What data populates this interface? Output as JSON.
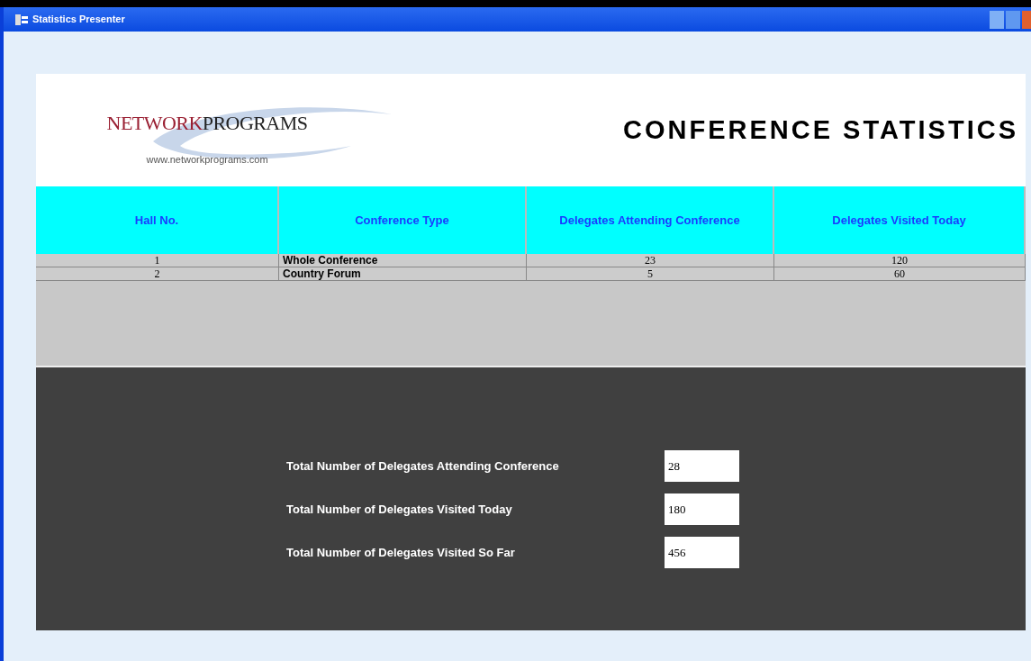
{
  "window": {
    "title": "Statistics Presenter"
  },
  "header": {
    "logo": {
      "part_1": "NETWORK",
      "part_2": "PROGRAMS",
      "url": "www.networkprograms.com"
    },
    "title": "CONFERENCE STATISTICS"
  },
  "table": {
    "columns": [
      "Hall No.",
      "Conference Type",
      "Delegates Attending Conference",
      "Delegates Visited Today"
    ],
    "rows": [
      [
        "1",
        "Whole Conference",
        "23",
        "120"
      ],
      [
        "2",
        "Country Forum",
        "5",
        "60"
      ]
    ]
  },
  "totals": [
    {
      "label": "Total Number of Delegates Attending Conference",
      "value": "28"
    },
    {
      "label": "Total Number of Delegates Visited Today",
      "value": "180"
    },
    {
      "label": "Total Number of Delegates Visited So Far",
      "value": "456"
    }
  ]
}
